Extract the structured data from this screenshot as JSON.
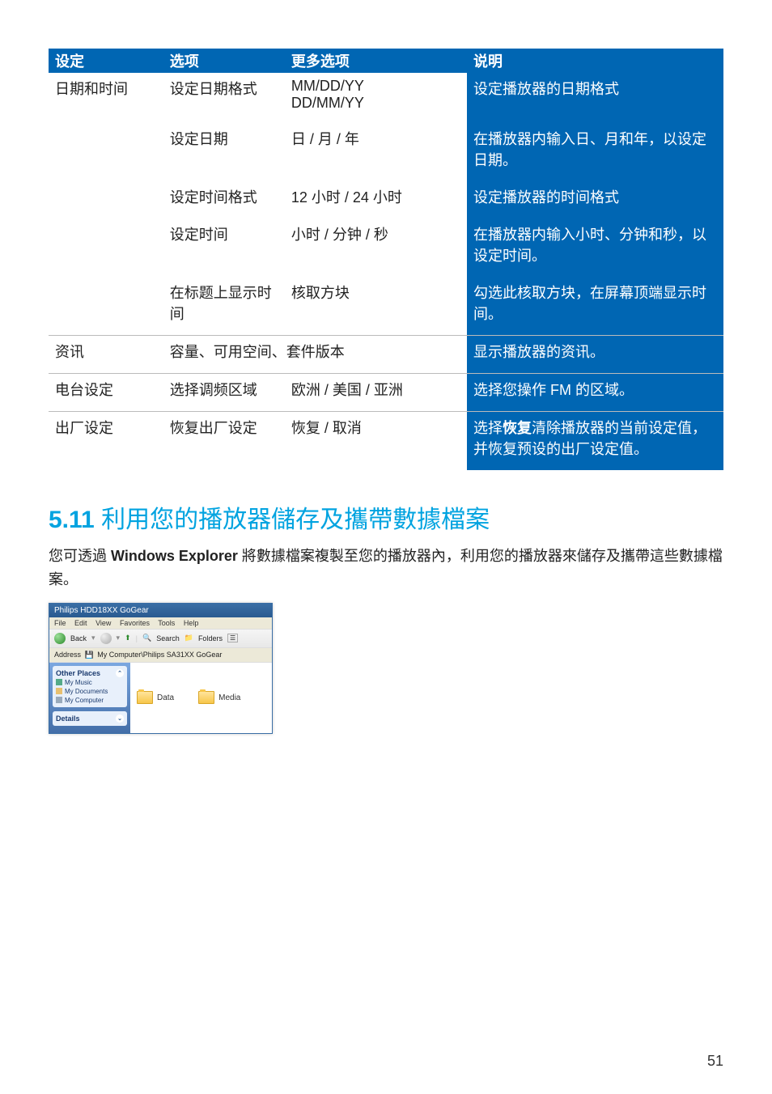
{
  "table": {
    "headers": {
      "setting": "设定",
      "option": "选项",
      "more": "更多选项",
      "desc": "说明"
    },
    "rows": [
      {
        "setting": "日期和时间",
        "option": "设定日期格式",
        "more": "MM/DD/YY\nDD/MM/YY",
        "desc": "设定播放器的日期格式",
        "divider": false
      },
      {
        "setting": "",
        "option": "设定日期",
        "more": "日 / 月 / 年",
        "desc": "在播放器内输入日、月和年，以设定日期。",
        "divider": false
      },
      {
        "setting": "",
        "option": "设定时间格式",
        "more": "12 小时 / 24 小时",
        "desc": "设定播放器的时间格式",
        "divider": false
      },
      {
        "setting": "",
        "option": "设定时间",
        "more": "小时 / 分钟 / 秒",
        "desc": "在播放器内输入小时、分钟和秒，以设定时间。",
        "divider": false
      },
      {
        "setting": "",
        "option": "在标题上显示时间",
        "more": "核取方块",
        "desc": "勾选此核取方块，在屏幕顶端显示时间。",
        "divider": false
      },
      {
        "setting": "资讯",
        "option": "容量、可用空间、套件版本",
        "more": "",
        "desc": "显示播放器的资讯。",
        "divider": true
      },
      {
        "setting": "电台设定",
        "option": "选择调频区域",
        "more": "欧洲 / 美国 / 亚洲",
        "desc": "选择您操作 FM 的区域。",
        "divider": true
      },
      {
        "setting": "出厂设定",
        "option": "恢复出厂设定",
        "more": "恢复 / 取消",
        "desc_pre": "选择",
        "desc_bold": "恢复",
        "desc_post": "清除播放器的当前设定值，并恢复预设的出厂设定值。",
        "divider": true
      }
    ]
  },
  "heading": {
    "num": "5.11",
    "title": "利用您的播放器儲存及攜帶數據檔案"
  },
  "paragraph": {
    "pre": "您可透過 ",
    "bold": "Windows Explorer",
    "post": " 將數據檔案複製至您的播放器內，利用您的播放器來儲存及攜帶這些數據檔案。"
  },
  "explorer": {
    "title": "Philips HDD18XX GoGear",
    "menu": [
      "File",
      "Edit",
      "View",
      "Favorites",
      "Tools",
      "Help"
    ],
    "toolbar": {
      "back": "Back",
      "search": "Search",
      "folders": "Folders"
    },
    "address_label": "Address",
    "address_value": "My Computer\\Philips SA31XX GoGear",
    "side": {
      "places_title": "Other Places",
      "places": [
        "My Music",
        "My Documents",
        "My Computer"
      ],
      "details_title": "Details"
    },
    "folders": [
      "Data",
      "Media"
    ]
  },
  "page_number": "51"
}
